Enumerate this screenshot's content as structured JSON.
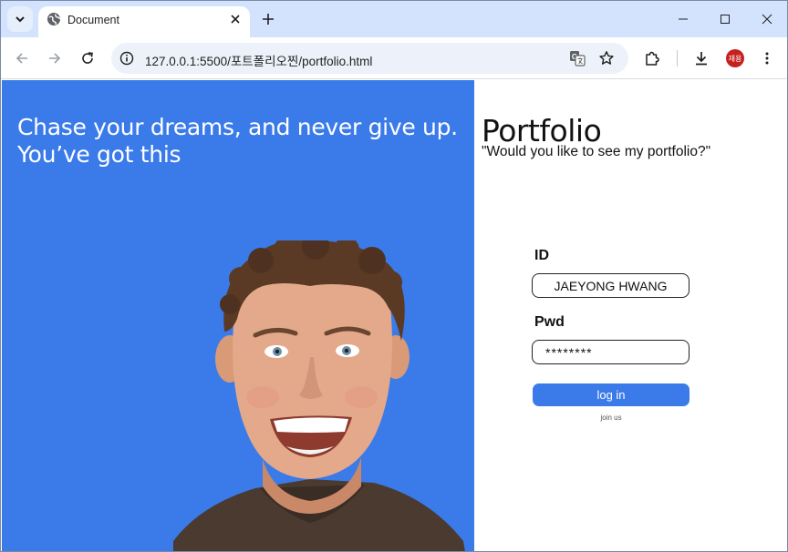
{
  "browser": {
    "tab_title": "Document",
    "url": "127.0.0.1:5500/포트폴리오찐/portfolio.html",
    "profile_initials": "재용",
    "icons": {
      "tab_search": "chevron-down-icon",
      "tab_favicon": "globe-icon",
      "tab_close": "close-icon",
      "new_tab": "plus-icon",
      "minimize": "minimize-icon",
      "maximize": "maximize-icon",
      "close_window": "close-icon",
      "back": "arrow-left-icon",
      "forward": "arrow-right-icon",
      "reload": "reload-icon",
      "site_info": "info-icon",
      "translate": "translate-icon",
      "bookmark": "star-icon",
      "extensions": "puzzle-icon",
      "downloads": "download-icon",
      "menu": "kebab-menu-icon"
    }
  },
  "hero": {
    "quote_line1": "Chase your dreams, and never give up.",
    "quote_line2": "You’ve got this",
    "background": "#3b7be9"
  },
  "login": {
    "brand": "Portfolio",
    "subtitle": "\"Would you like to see my portfolio?\"",
    "id_label": "ID",
    "id_value": "JAEYONG HWANG",
    "pwd_label": "Pwd",
    "pwd_value": "********",
    "login_label": "log in",
    "join_label": "join us",
    "accent": "#3b7be9"
  }
}
